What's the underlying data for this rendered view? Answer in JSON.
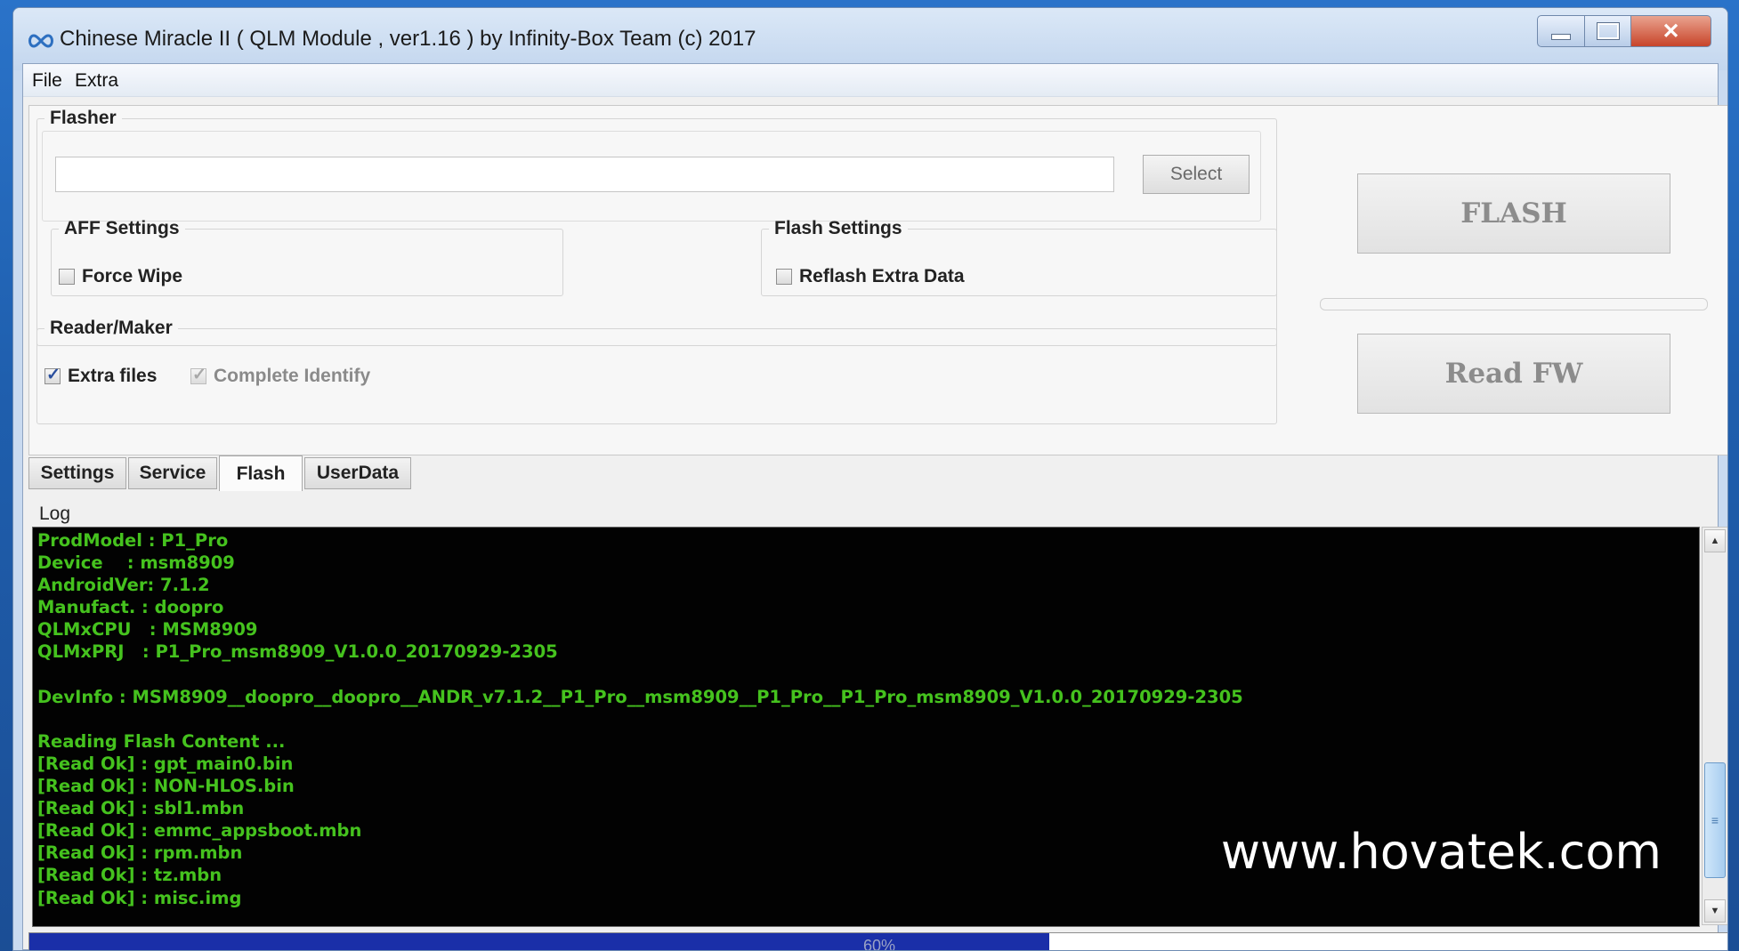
{
  "window": {
    "title": "Chinese Miracle II ( QLM Module , ver1.16  ) by Infinity-Box Team (c) 2017",
    "close_glyph": "✕"
  },
  "menu": {
    "file": "File",
    "extra": "Extra"
  },
  "flasher": {
    "legend": "Flasher",
    "path_value": "",
    "select_label": "Select"
  },
  "aff_settings": {
    "legend": "AFF Settings",
    "force_wipe": {
      "label": "Force Wipe",
      "checked": false
    }
  },
  "flash_settings": {
    "legend": "Flash Settings",
    "reflash_extra": {
      "label": "Reflash Extra Data",
      "checked": false
    }
  },
  "reader_maker": {
    "legend": "Reader/Maker",
    "extra_files": {
      "label": "Extra files",
      "checked": true
    },
    "complete_identify": {
      "label": "Complete Identify",
      "checked": true,
      "disabled": true
    }
  },
  "buttons": {
    "flash": "FLASH",
    "read_fw": "Read FW"
  },
  "tabs": [
    {
      "label": "Settings",
      "active": false
    },
    {
      "label": "Service",
      "active": false
    },
    {
      "label": "Flash",
      "active": true
    },
    {
      "label": "UserData",
      "active": false
    }
  ],
  "log": {
    "label": "Log",
    "color": "#45c21e",
    "lines": [
      "ProdModel : P1_Pro",
      "Device    : msm8909",
      "AndroidVer: 7.1.2",
      "Manufact. : doopro",
      "QLMxCPU   : MSM8909",
      "QLMxPRJ   : P1_Pro_msm8909_V1.0.0_20170929-2305",
      "",
      "DevInfo : MSM8909__doopro__doopro__ANDR_v7.1.2__P1_Pro__msm8909__P1_Pro__P1_Pro_msm8909_V1.0.0_20170929-2305",
      "",
      "Reading Flash Content ...",
      "[Read Ok] : gpt_main0.bin",
      "[Read Ok] : NON-HLOS.bin",
      "[Read Ok] : sbl1.mbn",
      "[Read Ok] : emmc_appsboot.mbn",
      "[Read Ok] : rpm.mbn",
      "[Read Ok] : tz.mbn",
      "[Read Ok] : misc.img"
    ]
  },
  "watermark": "www.hovatek.com",
  "progress": {
    "percent": 60,
    "label": "60%",
    "fill_color": "#1a2fa8"
  },
  "scrollbar": {
    "up_glyph": "▲",
    "down_glyph": "▼",
    "grip_glyph": "≡"
  }
}
